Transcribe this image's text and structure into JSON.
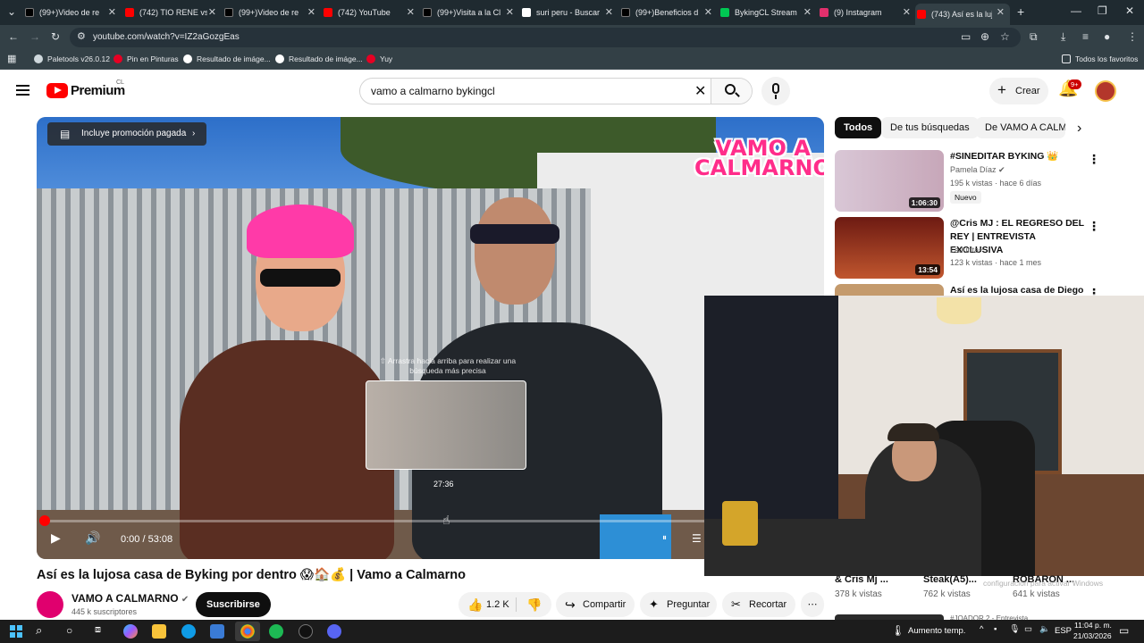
{
  "browser": {
    "tabs": [
      {
        "label": "(99+)Video de re",
        "color": "#000000"
      },
      {
        "label": "(742) TIO RENE vs",
        "color": "#ff0000"
      },
      {
        "label": "(99+)Video de re",
        "color": "#000000"
      },
      {
        "label": "(742) YouTube",
        "color": "#ff0000"
      },
      {
        "label": "(99+)Visita a la Cl",
        "color": "#000000"
      },
      {
        "label": "suri peru - Buscar",
        "color": "#4285f4"
      },
      {
        "label": "(99+)Beneficios d",
        "color": "#000000"
      },
      {
        "label": "BykingCL Stream",
        "color": "#00c853"
      },
      {
        "label": "(9) Instagram",
        "color": "#e1306c"
      },
      {
        "label": "(743) Así es la lujo",
        "color": "#ff0000"
      }
    ],
    "url": "youtube.com/watch?v=IZ2aGozgEas",
    "bookmarks": [
      "Paletools v26.0.12",
      "Pin en Pinturas",
      "Resultado de imáge...",
      "Resultado de imáge...",
      "Yuy"
    ],
    "all_favorites": "Todos los favoritos"
  },
  "youtube": {
    "logo": "Premium",
    "country": "CL",
    "search_query": "vamo a calmarno bykingcl",
    "create_label": "Crear",
    "notif_count": "9+"
  },
  "video": {
    "promo_label": "Incluye promoción pagada",
    "logo_text_1": "VAMO A",
    "logo_text_2": "CALMARNO",
    "preview_hint": "⇧ Arrastra hacia arriba para realizar una búsqueda más precisa",
    "preview_time": "27:36",
    "time": "0:00 / 53:08",
    "title": "Así es la lujosa casa de Byking por dentro 😱🏠💰 | Vamo a Calmarno",
    "channel": "VAMO A CALMARNO",
    "subscribers": "445 k suscriptores",
    "subscribe_label": "Suscribirse",
    "likes": "1.2 K",
    "share_label": "Compartir",
    "ask_label": "Preguntar",
    "clip_label": "Recortar"
  },
  "chips": [
    "Todos",
    "De tus búsquedas",
    "De VAMO A CALMARNO"
  ],
  "recommendations": [
    {
      "title": "#SINEDITAR BYKING 👑",
      "channel": "Pamela Díaz",
      "meta": "195 k vistas · hace 6 días",
      "badge": "Nuevo",
      "duration": "1:06:30",
      "thumb": "#d9c7d6"
    },
    {
      "title": "@Cris MJ : EL REGRESO DEL REY | ENTREVISTA EXCLUSIVA",
      "channel": "LaJunta+",
      "meta": "123 k vistas · hace 1 mes",
      "badge": "",
      "duration": "13:54",
      "thumb": "#b33a2a"
    },
    {
      "title": "Así es la lujosa casa de Diego",
      "channel": "",
      "meta": "",
      "badge": "",
      "duration": "",
      "thumb": "#c49a6c"
    }
  ],
  "under_cam": {
    "items": [
      {
        "title": "& Cris Mj ...",
        "views": "378 k vistas"
      },
      {
        "title": "Steak(A5)...",
        "views": "762 k vistas"
      },
      {
        "title": "ROBARON ...",
        "views": "641 k vistas"
      }
    ],
    "next_title": "#JOADOR 2 - Entrevista..."
  },
  "watermark": "configuración para activar Windows",
  "taskbar": {
    "weather": "Aumento temp.",
    "lang": "ESP",
    "time": "11:04 p. m.",
    "date": "21/03/2026"
  }
}
